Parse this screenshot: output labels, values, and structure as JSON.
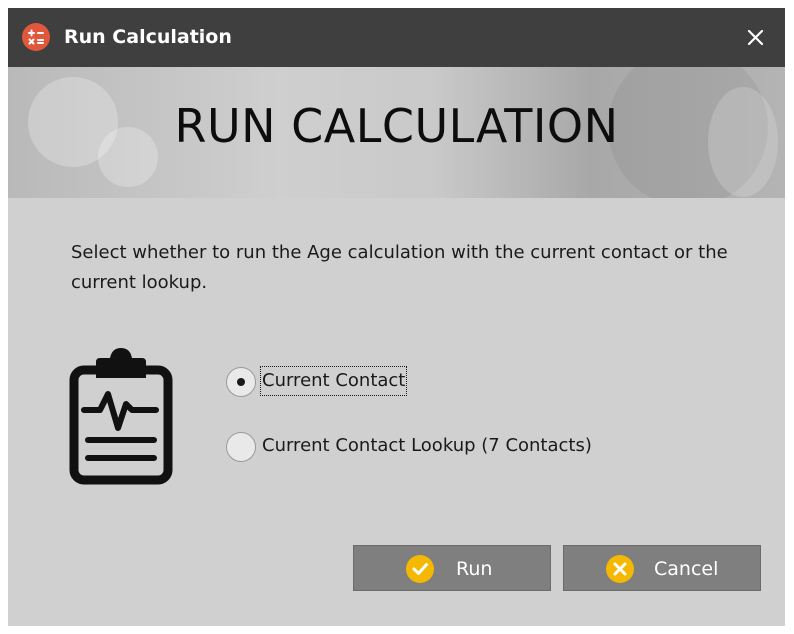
{
  "window": {
    "title": "Run Calculation",
    "app_icon": "calculator-icon",
    "close_icon": "close-icon"
  },
  "banner": {
    "heading": "RUN CALCULATION"
  },
  "body": {
    "instructions": "Select whether to run the Age calculation with the current contact or the current lookup.",
    "icon": "clipboard-heartbeat-icon"
  },
  "options": {
    "selected": "current_contact",
    "current_contact": "Current Contact",
    "current_lookup": "Current Contact Lookup (7 Contacts)"
  },
  "buttons": {
    "run_label": "Run",
    "run_icon": "check-circle-icon",
    "cancel_label": "Cancel",
    "cancel_icon": "x-circle-icon"
  },
  "colors": {
    "titlebar": "#3f3f3f",
    "dialog_bg": "#d0d0d0",
    "button_bg": "#7f7f7f",
    "accent_yellow": "#f5b800",
    "app_icon": "#e0583c"
  }
}
